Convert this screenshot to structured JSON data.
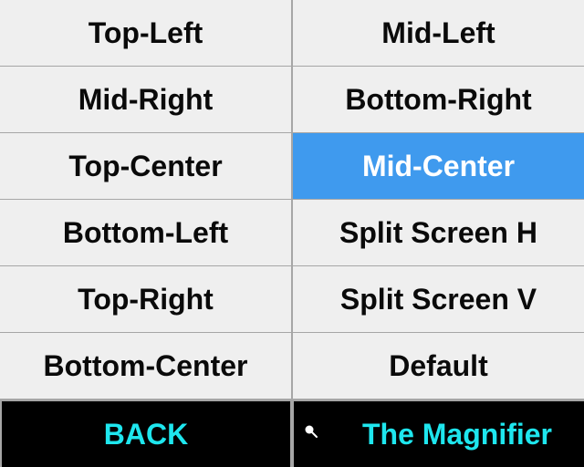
{
  "menu": {
    "items": [
      {
        "label": "Top-Left"
      },
      {
        "label": "Mid-Left"
      },
      {
        "label": "Mid-Right"
      },
      {
        "label": "Bottom-Right"
      },
      {
        "label": "Top-Center"
      },
      {
        "label": "Mid-Center",
        "selected": true
      },
      {
        "label": "Bottom-Left"
      },
      {
        "label": "Split Screen H"
      },
      {
        "label": "Top-Right"
      },
      {
        "label": "Split Screen V"
      },
      {
        "label": "Bottom-Center"
      },
      {
        "label": "Default"
      }
    ],
    "back_label": "BACK",
    "magnifier_label": "The Magnifier",
    "magnifier_icon": "magnifier-icon"
  },
  "colors": {
    "cell_bg": "#efefef",
    "selected_bg": "#3f9aee",
    "selected_text": "#ffffff",
    "footer_bg": "#000000",
    "footer_text": "#1ee6ee"
  }
}
